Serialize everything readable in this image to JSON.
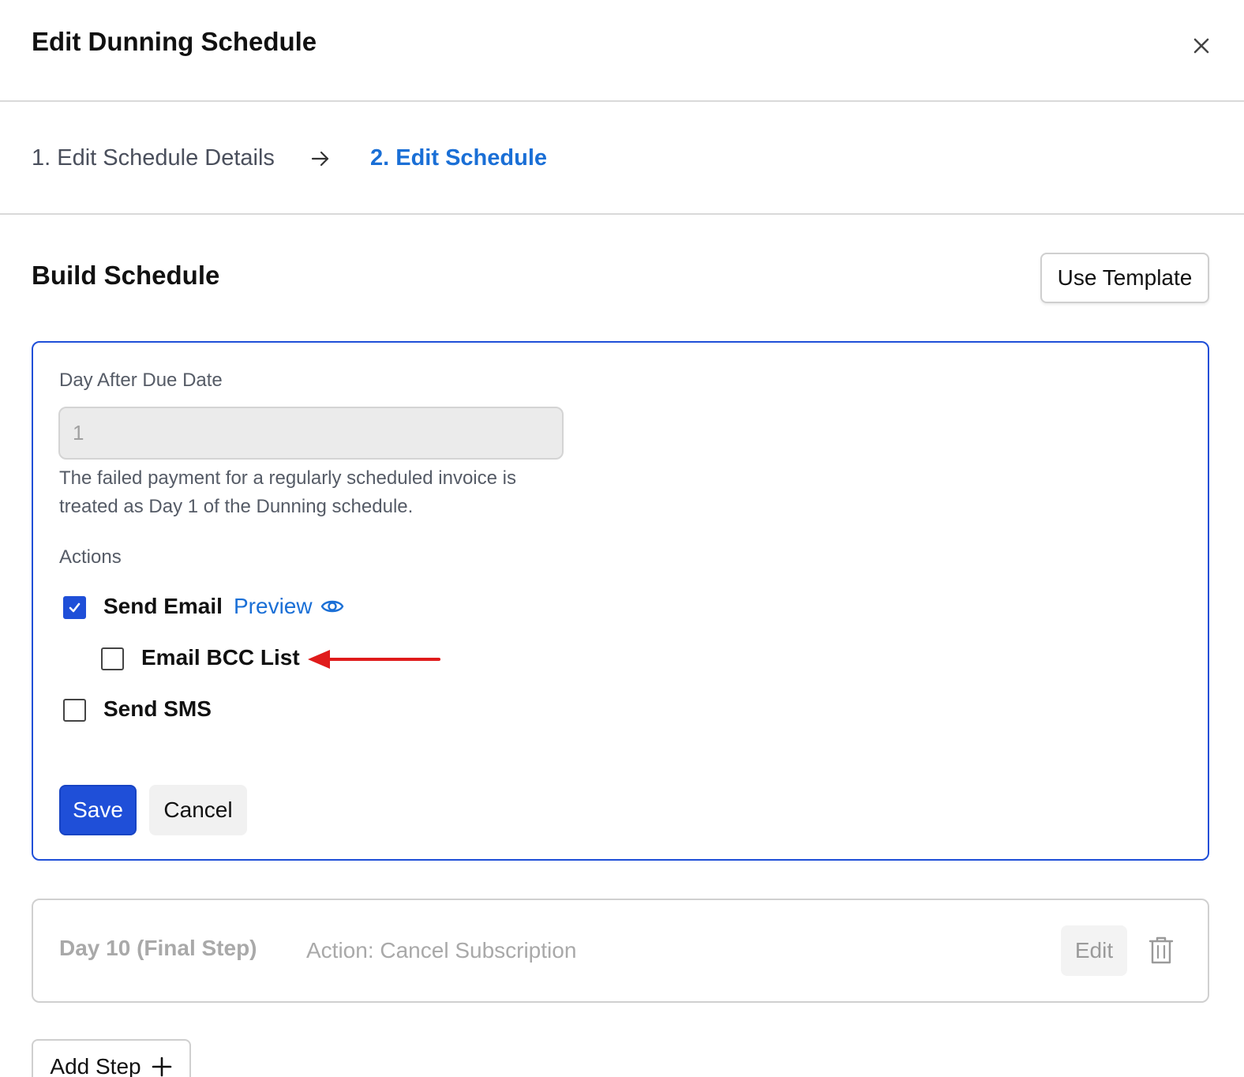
{
  "header": {
    "title": "Edit Dunning Schedule",
    "close_icon": "close-icon"
  },
  "stepper": {
    "step1_label": "1. Edit Schedule Details",
    "step2_label": "2. Edit Schedule",
    "active_step": 2,
    "active_color": "#1a6fd6"
  },
  "build": {
    "title": "Build Schedule",
    "use_template_label": "Use Template"
  },
  "step_form": {
    "day_label": "Day After Due Date",
    "day_value": "1",
    "help_text": "The failed payment for a regularly scheduled invoice is treated as Day 1 of the Dunning schedule.",
    "actions_label": "Actions",
    "actions": {
      "send_email": {
        "label": "Send Email",
        "checked": true
      },
      "preview_label": "Preview",
      "email_bcc": {
        "label": "Email BCC List",
        "checked": false
      },
      "send_sms": {
        "label": "Send SMS",
        "checked": false
      }
    },
    "save_label": "Save",
    "cancel_label": "Cancel",
    "accent_color": "#1f4fd8"
  },
  "final_step": {
    "day_label": "Day 10 (Final Step)",
    "action_text": "Action: Cancel Subscription",
    "edit_label": "Edit"
  },
  "add_step_label": "Add Step"
}
